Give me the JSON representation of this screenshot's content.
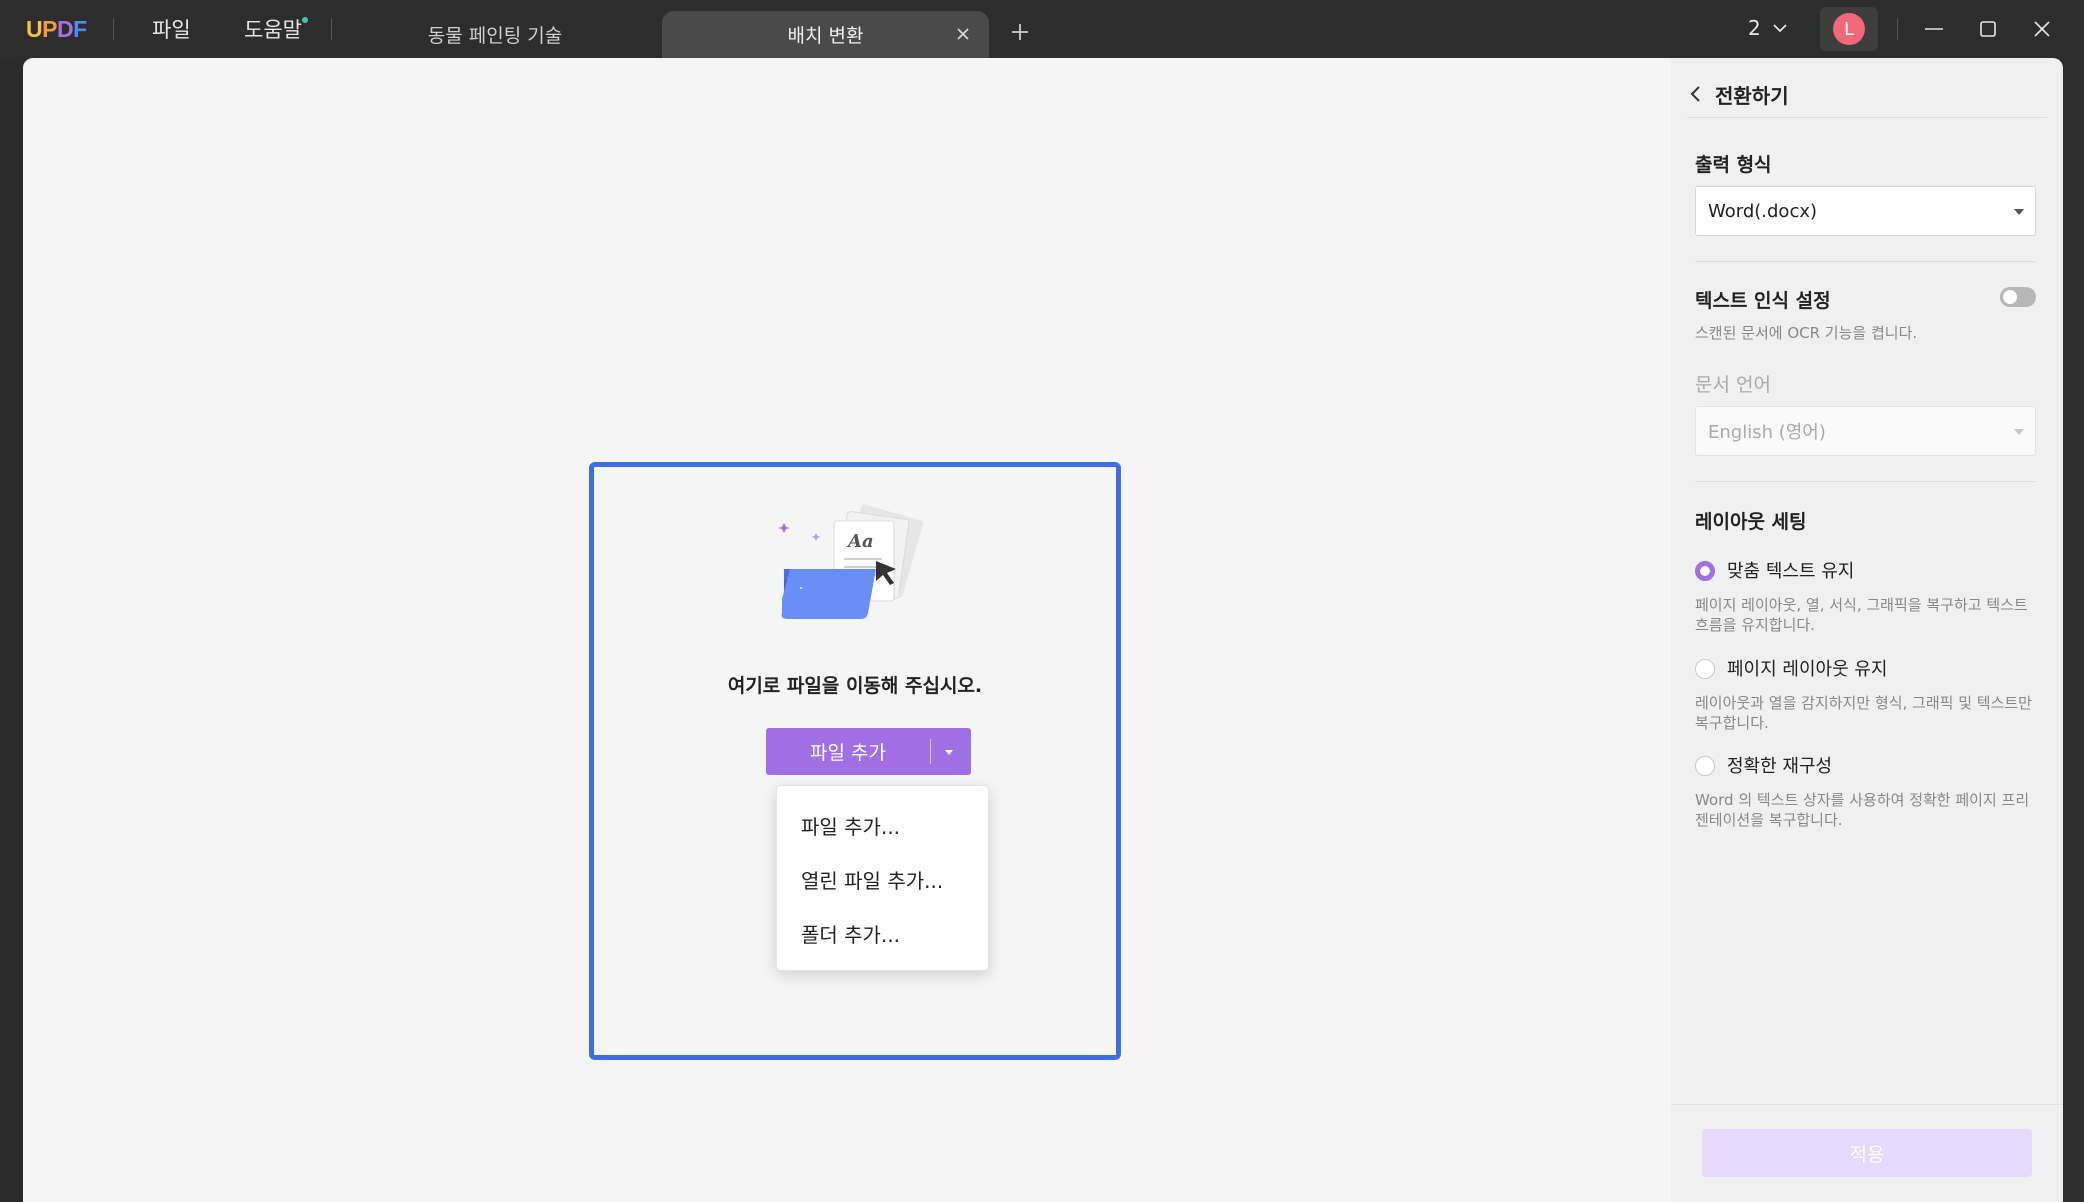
{
  "app": {
    "logo_letters": [
      "U",
      "P",
      "D",
      "F"
    ],
    "logo_colors": [
      "#f7c23c",
      "#f29a3f",
      "#a86ee3",
      "#4b8cf7"
    ],
    "menu": [
      {
        "label": "파일"
      },
      {
        "label": "도움말"
      }
    ]
  },
  "tabs": [
    {
      "label": "동물 페인팅 기술",
      "active": false
    },
    {
      "label": "배치 변환",
      "active": true
    }
  ],
  "titlebar_right": {
    "window_count": "2",
    "avatar_initial": "L",
    "avatar_color": "#f3687a"
  },
  "dropzone": {
    "instruction": "여기로 파일을 이동해 주십시오.",
    "add_button_label": "파일 추가",
    "menu_items": [
      "파일 추가...",
      "열린 파일 추가...",
      "폴더 추가..."
    ],
    "border_color": "#3c6fe3"
  },
  "panel": {
    "title": "전환하기",
    "output_format_label": "출력 형식",
    "output_format_value": "Word(.docx)",
    "ocr_label": "텍스트 인식 설정",
    "ocr_enabled": false,
    "ocr_hint": "스캔된 문서에 OCR 기능을 켭니다.",
    "doc_language_label": "문서 언어",
    "doc_language_value": "English (영어)",
    "layout_label": "레이아웃 세팅",
    "layout_options": [
      {
        "label": "맞춤 텍스트 유지",
        "desc": "페이지 레이아웃, 열, 서식, 그래픽을 복구하고 텍스트 흐름을 유지합니다.",
        "checked": true
      },
      {
        "label": "페이지 레이아웃 유지",
        "desc": "레이아웃과 열을 감지하지만 형식, 그래픽 및 텍스트만 복구합니다.",
        "checked": false
      },
      {
        "label": "정확한 재구성",
        "desc": "Word 의 텍스트 상자를 사용하여 정확한 페이지 프리젠테이션을 복구합니다.",
        "checked": false
      }
    ],
    "apply_label": "적용",
    "accent_color": "#a06fe3"
  }
}
